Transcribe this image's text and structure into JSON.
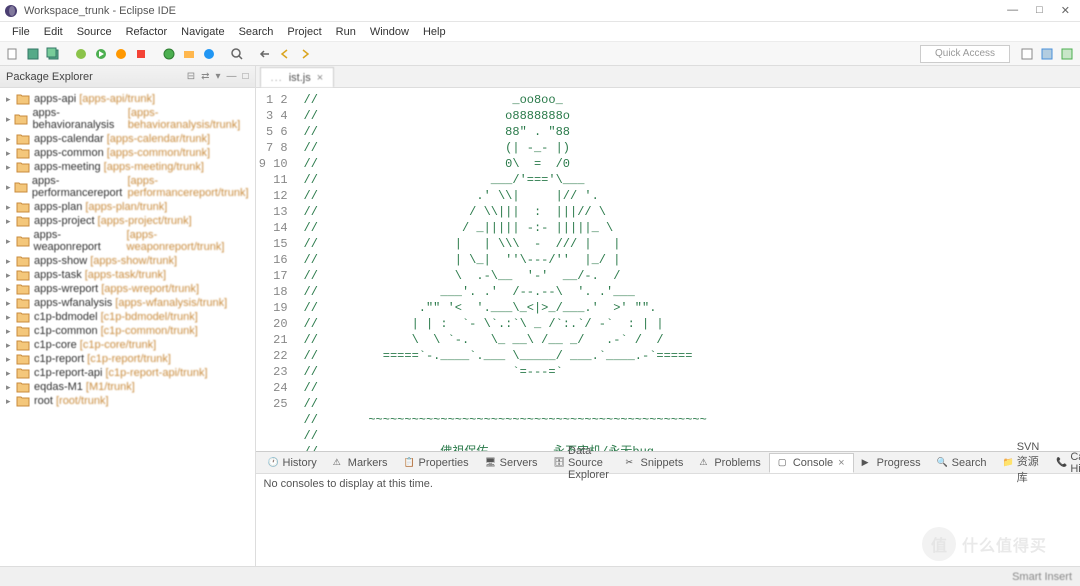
{
  "window": {
    "title": "Workspace_trunk - Eclipse IDE",
    "min": "—",
    "max": "□",
    "close": "✕"
  },
  "menu": [
    "File",
    "Edit",
    "Source",
    "Refactor",
    "Navigate",
    "Search",
    "Project",
    "Run",
    "Window",
    "Help"
  ],
  "quick_access": "Quick Access",
  "explorer": {
    "title": "Package Explorer",
    "items": [
      {
        "name": "apps-api",
        "loc": "[apps-api/trunk]"
      },
      {
        "name": "apps-behavioranalysis",
        "loc": "[apps-behavioranalysis/trunk]"
      },
      {
        "name": "apps-calendar",
        "loc": "[apps-calendar/trunk]"
      },
      {
        "name": "apps-common",
        "loc": "[apps-common/trunk]"
      },
      {
        "name": "apps-meeting",
        "loc": "[apps-meeting/trunk]"
      },
      {
        "name": "apps-performancereport",
        "loc": "[apps-performancereport/trunk]"
      },
      {
        "name": "apps-plan",
        "loc": "[apps-plan/trunk]"
      },
      {
        "name": "apps-project",
        "loc": "[apps-project/trunk]"
      },
      {
        "name": "apps-weaponreport",
        "loc": "[apps-weaponreport/trunk]"
      },
      {
        "name": "apps-show",
        "loc": "[apps-show/trunk]"
      },
      {
        "name": "apps-task",
        "loc": "[apps-task/trunk]"
      },
      {
        "name": "apps-wreport",
        "loc": "[apps-wreport/trunk]"
      },
      {
        "name": "apps-wfanalysis",
        "loc": "[apps-wfanalysis/trunk]"
      },
      {
        "name": "c1p-bdmodel",
        "loc": "[c1p-bdmodel/trunk]"
      },
      {
        "name": "c1p-common",
        "loc": "[c1p-common/trunk]"
      },
      {
        "name": "c1p-core",
        "loc": "[c1p-core/trunk]"
      },
      {
        "name": "c1p-report",
        "loc": "[c1p-report/trunk]"
      },
      {
        "name": "c1p-report-api",
        "loc": "[c1p-report-api/trunk]"
      },
      {
        "name": "eqdas-M1",
        "loc": "[M1/trunk]"
      },
      {
        "name": "root",
        "loc": "[root/trunk]"
      }
    ]
  },
  "editor": {
    "tab_label": "ist.js",
    "tab_prefix": "...",
    "lines": [
      "//                           _oo8oo_",
      "//                          o8888888o",
      "//                          88\" . \"88",
      "//                          (| -_- |)",
      "//                          0\\  =  /0",
      "//                        ___/'==='\\___",
      "//                      .' \\\\|     |// '.",
      "//                     / \\\\|||  :  |||// \\",
      "//                    / _||||| -:- |||||_ \\",
      "//                   |   | \\\\\\  -  /// |   |",
      "//                   | \\_|  ''\\---/''  |_/ |",
      "//                   \\  .-\\__  '-'  __/-.  /",
      "//                 ___'. .'  /--.--\\  '. .'___",
      "//              .\"\" '<  '.___\\_<|>_/___.'  >' \"\".",
      "//             | | :  `- \\`.:`\\ _ /`:.`/ -`  : | |",
      "//             \\  \\ `-.   \\_ __\\ /__ _/   .-` /  /",
      "//         =====`-.____`.___ \\_____/ ___.`____.-`=====",
      "//                           `=---=`",
      "//",
      "//",
      "//       ~~~~~~~~~~~~~~~~~~~~~~~~~~~~~~~~~~~~~~~~~~~~~~~",
      "//",
      "//                 佛祖保佑         永不宕机/永无bug"
    ]
  },
  "bottom": {
    "tabs": [
      "History",
      "Markers",
      "Properties",
      "Servers",
      "Data Source Explorer",
      "Snippets",
      "Problems",
      "Console",
      "Progress",
      "Search",
      "SVN 资源库",
      "Call Hierarchy"
    ],
    "active_index": 7,
    "content": "No consoles to display at this time."
  },
  "status": {
    "right": "Smart Insert"
  },
  "watermark": {
    "circle": "值",
    "text": "什么值得买"
  }
}
